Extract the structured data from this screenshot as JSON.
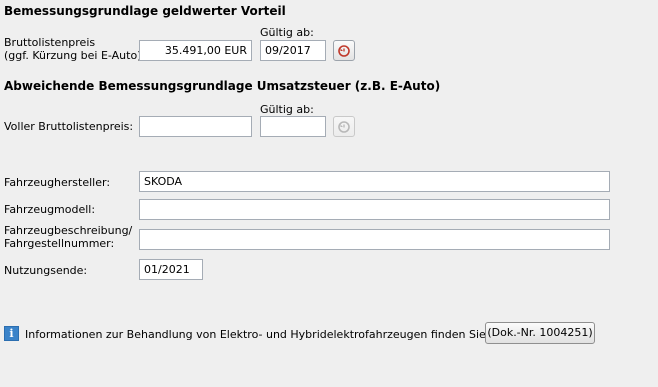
{
  "section1": {
    "title": "Bemessungsgrundlage geldwerter Vorteil",
    "list_price_label_line1": "Bruttolistenpreis",
    "list_price_label_line2": "(ggf. Kürzung bei E-Auto):",
    "list_price_value": "35.491,00 EUR",
    "valid_from_label": "Gültig ab:",
    "valid_from_value": "09/2017",
    "restore_icon": "restore-icon"
  },
  "section2": {
    "title": "Abweichende Bemessungsgrundlage Umsatzsteuer (z.B. E-Auto)",
    "valid_from_label": "Gültig ab:",
    "full_list_price_label": "Voller Bruttolistenpreis:",
    "full_list_price_value": "",
    "valid_from_value": "",
    "restore_icon": "restore-icon"
  },
  "vehicle": {
    "manufacturer_label": "Fahrzeughersteller:",
    "manufacturer_value": "SKODA",
    "model_label": "Fahrzeugmodell:",
    "model_value": "",
    "description_label_line1": "Fahrzeugbeschreibung/",
    "description_label_line2": "Fahrgestellnummer:",
    "description_value": "",
    "usage_end_label": "Nutzungsende:",
    "usage_end_value": "01/2021"
  },
  "info": {
    "icon": "info-icon",
    "text": "Informationen zur Behandlung von Elektro- und Hybridelektrofahrzeugen finden Sie im Dokument",
    "doc_button_label": "(Dok.-Nr. 1004251)"
  },
  "colors": {
    "background": "#efefef",
    "input_border": "#a5acb5",
    "info_icon": "#3a83c9",
    "restore_icon_red": "#c0392b"
  }
}
